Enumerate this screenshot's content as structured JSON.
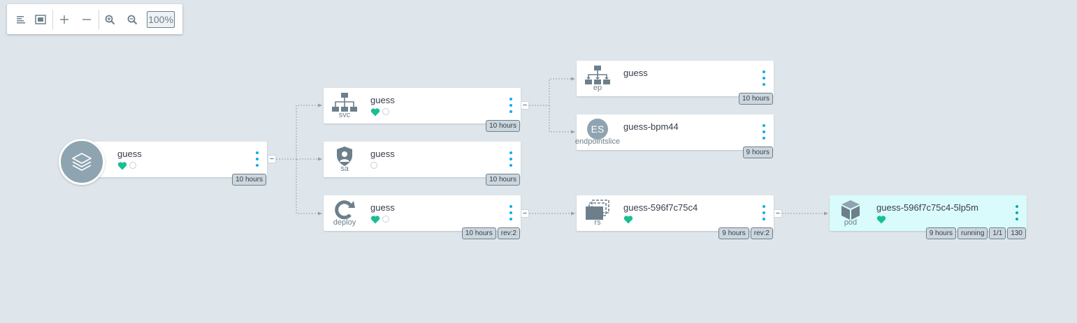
{
  "toolbar": {
    "zoom": "100%",
    "icons": [
      "align-left-icon",
      "fit-screen-icon",
      "expand-icon",
      "collapse-icon",
      "zoom-in-icon",
      "zoom-out-icon"
    ]
  },
  "colors": {
    "healthy": "#18be94",
    "accent": "#0dadea",
    "icon": "#6d7f8b",
    "tag_bg": "#ccd6dd",
    "pod_bg": "#d9fbfb"
  },
  "nodes": {
    "app": {
      "label": "guess",
      "tags": [
        "10 hours"
      ]
    },
    "svc": {
      "label": "guess",
      "kind": "svc",
      "tags": [
        "10 hours"
      ]
    },
    "sa": {
      "label": "guess",
      "kind": "sa",
      "tags": [
        "10 hours"
      ]
    },
    "deploy": {
      "label": "guess",
      "kind": "deploy",
      "tags": [
        "10 hours",
        "rev:2"
      ]
    },
    "ep": {
      "label": "guess",
      "kind": "ep",
      "tags": [
        "10 hours"
      ]
    },
    "endpointslice": {
      "label": "guess-bpm44",
      "kind": "endpointslice",
      "icon_text": "ES",
      "tags": [
        "9 hours"
      ]
    },
    "rs": {
      "label": "guess-596f7c75c4",
      "kind": "rs",
      "tags": [
        "9 hours",
        "rev:2"
      ]
    },
    "pod": {
      "label": "guess-596f7c75c4-5lp5m",
      "kind": "pod",
      "tags": [
        "9 hours",
        "running",
        "1/1",
        "130"
      ]
    }
  }
}
